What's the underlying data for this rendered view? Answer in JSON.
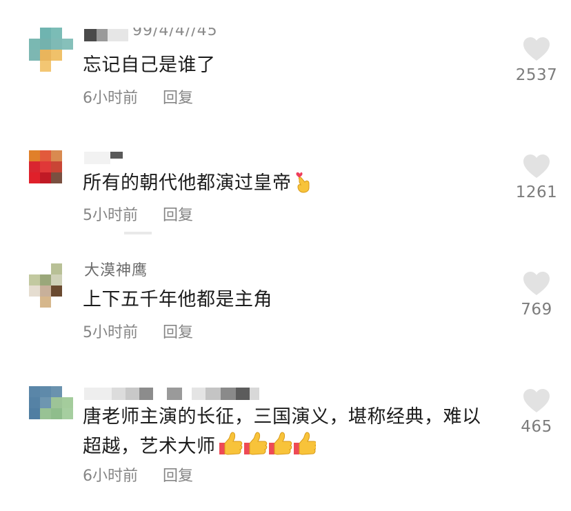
{
  "comments": [
    {
      "username_visible": "99/4/4//45",
      "text": "忘记自己是谁了",
      "time": "6小时前",
      "reply_label": "回复",
      "likes": "2537"
    },
    {
      "username_visible": "",
      "text": "所有的朝代他都演过皇帝",
      "emoji": "crossed-fingers-heart-emoji",
      "time": "5小时前",
      "reply_label": "回复",
      "likes": "1261"
    },
    {
      "username_visible": "大漠神鹰",
      "text": "上下五千年他都是主角",
      "time": "5小时前",
      "reply_label": "回复",
      "likes": "769"
    },
    {
      "username_visible": "",
      "text": "唐老师主演的长征，三国演义，堪称经典，难以超越，艺术大师",
      "emoji": "thumbs-up-emoji-x4",
      "time": "6小时前",
      "reply_label": "回复",
      "likes": "465"
    }
  ],
  "colors": {
    "text": "#1c1c1c",
    "meta": "#858585",
    "like_icon": "#e2e2e2",
    "like_count": "#7c7c7c"
  }
}
